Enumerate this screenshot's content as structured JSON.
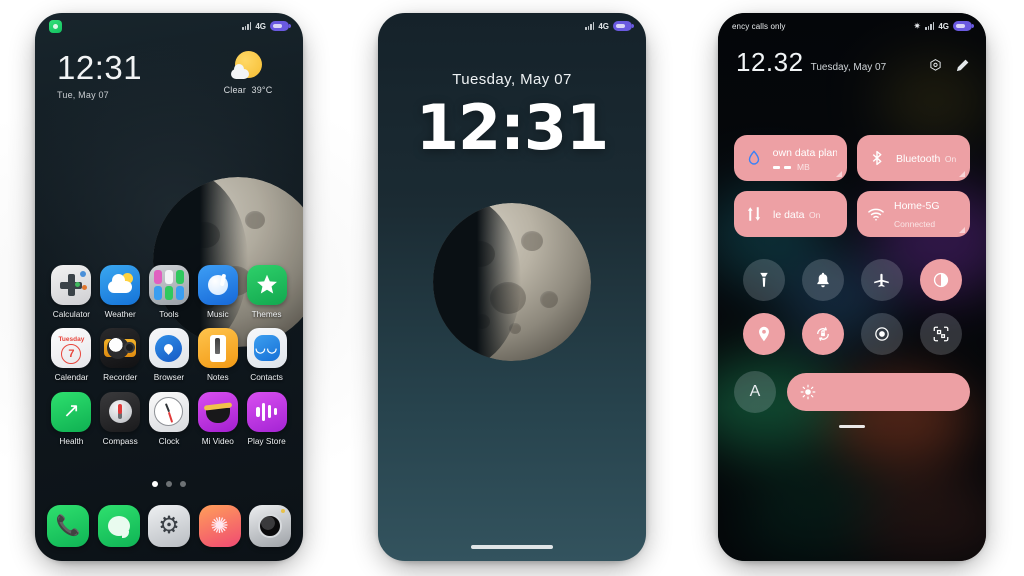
{
  "phone1": {
    "name": "home-screen",
    "statusbar": {
      "notification_dot": "green-dot",
      "network": "4G",
      "signal": "signal-bars-icon",
      "battery": "battery-icon"
    },
    "clock": {
      "time": "12:31",
      "date": "Tue, May 07"
    },
    "weather": {
      "icon": "sun-behind-cloud-icon",
      "condition": "Clear",
      "temperature": "39°C"
    },
    "apps": [
      {
        "label": "Calculator",
        "icon": "calculator-icon"
      },
      {
        "label": "Weather",
        "icon": "weather-icon"
      },
      {
        "label": "Tools",
        "icon": "folder-tools-icon"
      },
      {
        "label": "Music",
        "icon": "music-icon"
      },
      {
        "label": "Themes",
        "icon": "themes-icon"
      },
      {
        "label": "Calendar",
        "icon": "calendar-icon",
        "cal_day": "Tuesday",
        "cal_num": "7"
      },
      {
        "label": "Recorder",
        "icon": "recorder-icon"
      },
      {
        "label": "Browser",
        "icon": "browser-icon"
      },
      {
        "label": "Notes",
        "icon": "notes-icon"
      },
      {
        "label": "Contacts",
        "icon": "contacts-icon"
      },
      {
        "label": "Health",
        "icon": "health-icon"
      },
      {
        "label": "Compass",
        "icon": "compass-icon"
      },
      {
        "label": "Clock",
        "icon": "clock-icon"
      },
      {
        "label": "Mi Video",
        "icon": "mi-video-icon"
      },
      {
        "label": "Play Store",
        "icon": "play-store-icon"
      }
    ],
    "page_dots": {
      "count": 3,
      "active": 1
    },
    "dock": [
      {
        "label": "Phone",
        "icon": "phone-icon"
      },
      {
        "label": "Messages",
        "icon": "message-icon"
      },
      {
        "label": "Settings",
        "icon": "gear-icon"
      },
      {
        "label": "Mi Store",
        "icon": "flower-icon"
      },
      {
        "label": "Camera",
        "icon": "camera-icon"
      }
    ]
  },
  "phone2": {
    "name": "lock-screen",
    "statusbar": {
      "network": "4G",
      "signal": "signal-bars-icon",
      "battery": "battery-icon"
    },
    "date": "Tuesday, May 07",
    "time": "12:31",
    "wallpaper": "half-moon-image",
    "home_indicator": "home-indicator"
  },
  "phone3": {
    "name": "control-center",
    "statusbar": {
      "carrier": "ency calls only",
      "bluetooth": "bluetooth-icon",
      "network": "4G",
      "signal": "signal-bars-icon",
      "battery": "battery-icon"
    },
    "header": {
      "time": "12.32",
      "date": "Tuesday, May 07",
      "settings_label": "settings-icon",
      "edit_label": "edit-pencil-icon"
    },
    "tiles": [
      {
        "title": "own data plan",
        "subtitle": "-- MB",
        "icon": "data-drop-icon",
        "state": "on"
      },
      {
        "title": "Bluetooth",
        "subtitle": "On",
        "icon": "bluetooth-icon",
        "state": "on"
      },
      {
        "title": "le data",
        "subtitle": "On",
        "icon": "mobile-data-icon",
        "state": "on"
      },
      {
        "title": "Home-5G",
        "subtitle": "Connected",
        "icon": "wifi-icon",
        "state": "on"
      }
    ],
    "toggles": [
      {
        "name": "flashlight",
        "icon": "flashlight-icon",
        "state": "off"
      },
      {
        "name": "ringer",
        "icon": "bell-icon",
        "state": "off"
      },
      {
        "name": "airplane-mode",
        "icon": "airplane-icon",
        "state": "off"
      },
      {
        "name": "dark-mode",
        "icon": "dark-mode-icon",
        "state": "on"
      },
      {
        "name": "location",
        "icon": "location-pin-icon",
        "state": "on"
      },
      {
        "name": "rotation-lock",
        "icon": "rotation-lock-icon",
        "state": "on"
      },
      {
        "name": "screen-record",
        "icon": "record-icon",
        "state": "off"
      },
      {
        "name": "scan-qr",
        "icon": "qr-scan-icon",
        "state": "off"
      }
    ],
    "brightness": {
      "auto_label": "A",
      "icon": "brightness-sun-icon",
      "level": 100
    },
    "drag_handle": "drag-handle"
  },
  "colors": {
    "accent_pink": "#eda0a4",
    "home_bg": "#12202a",
    "lock_bg": "#27434d",
    "battery_purple": "#6a5ae0",
    "green": "#2fe06e"
  }
}
